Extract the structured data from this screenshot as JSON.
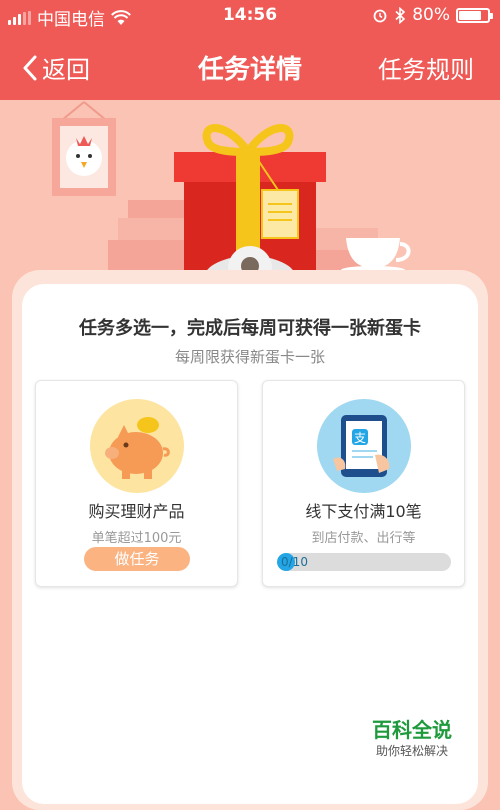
{
  "status_bar": {
    "carrier": "中国电信",
    "time": "14:56",
    "battery_percent_label": "80%",
    "battery_level": 0.8,
    "icons": [
      "signal-icon",
      "wifi-icon",
      "alarm-icon",
      "bluetooth-icon",
      "battery-icon"
    ]
  },
  "nav": {
    "back_label": "返回",
    "title": "任务详情",
    "rules_label": "任务规则"
  },
  "card": {
    "headline": "任务多选一，完成后每周可获得一张新蛋卡",
    "subline": "每周限获得新蛋卡一张"
  },
  "tasks": [
    {
      "icon": "piggy-bank-icon",
      "title": "购买理财产品",
      "desc": "单笔超过100元",
      "button_label": "做任务"
    },
    {
      "icon": "alipay-tablet-icon",
      "title": "线下支付满10笔",
      "desc": "到店付款、出行等",
      "progress_label": "0/10",
      "progress": 0
    }
  ],
  "watermark": {
    "title": "百科全说",
    "subtitle": "助你轻松解决"
  },
  "colors": {
    "header_red": "#ef5a56",
    "background_pink": "#fbc3b3",
    "button_orange": "#fbb382",
    "progress_blue": "#23a6e6",
    "watermark_green": "#1e9a3c"
  }
}
